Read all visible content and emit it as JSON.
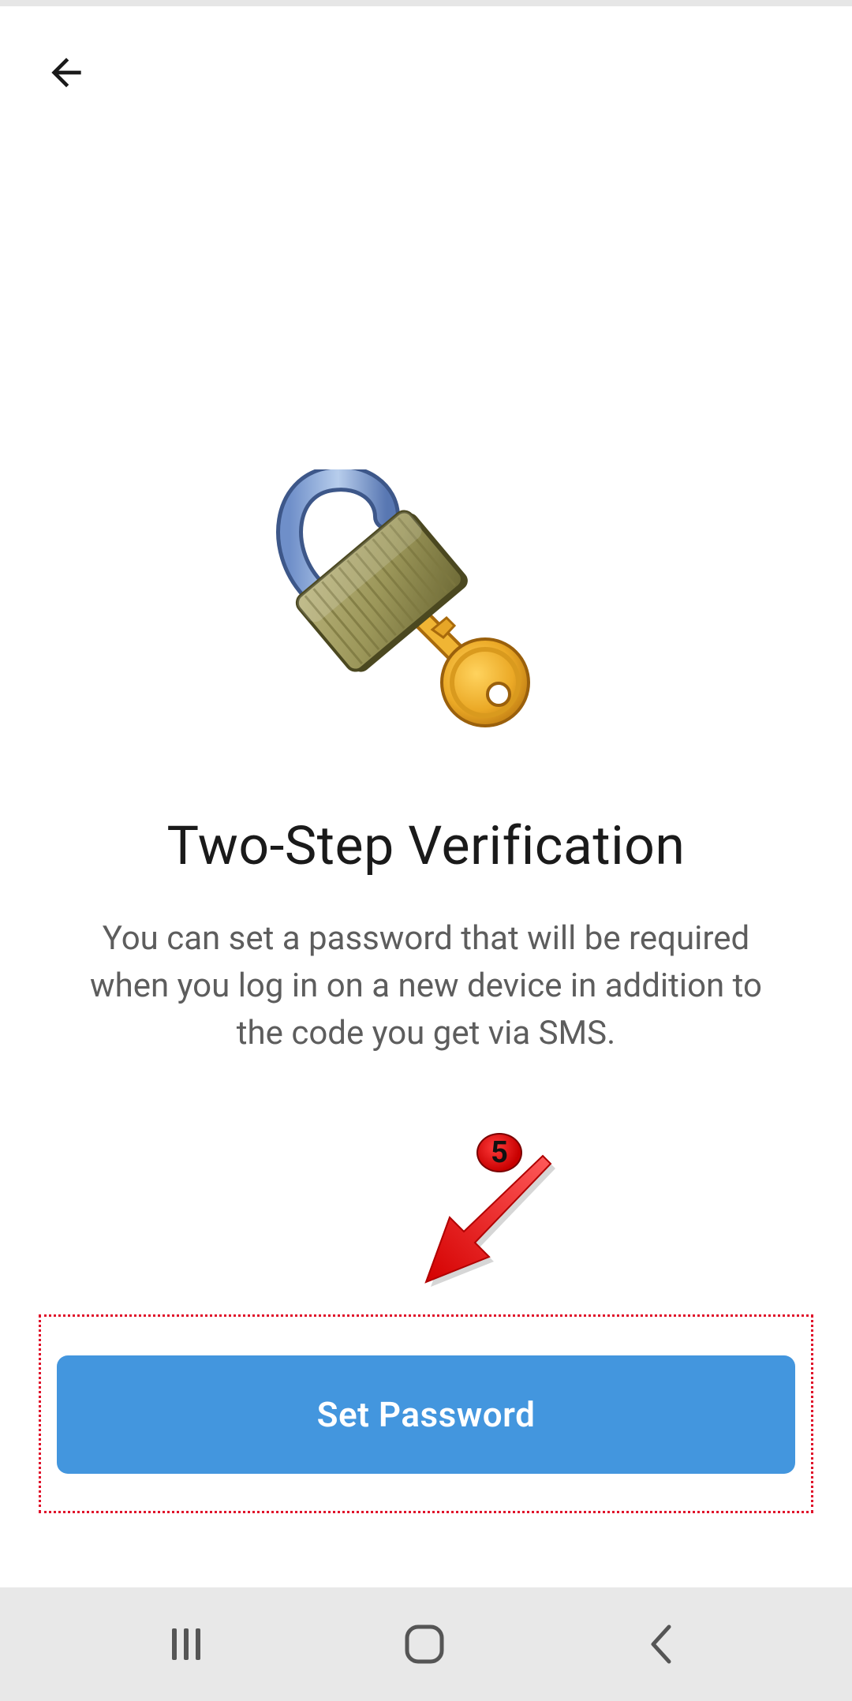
{
  "header": {
    "back_icon": "arrow-left-icon"
  },
  "hero": {
    "icon": "lock-with-key-icon"
  },
  "content": {
    "title": "Two-Step Verification",
    "description": "You can set a password that will be required when you log in on a new device in addition to the code you get via SMS."
  },
  "annotation": {
    "step_number": "5",
    "arrow_color": "#e81010",
    "highlight_color": "#e0102a"
  },
  "actions": {
    "set_password_label": "Set Password",
    "button_color": "#4396de"
  },
  "navigation_bar": {
    "recents_icon": "recents-icon",
    "home_icon": "home-icon",
    "back_icon": "nav-back-icon"
  }
}
